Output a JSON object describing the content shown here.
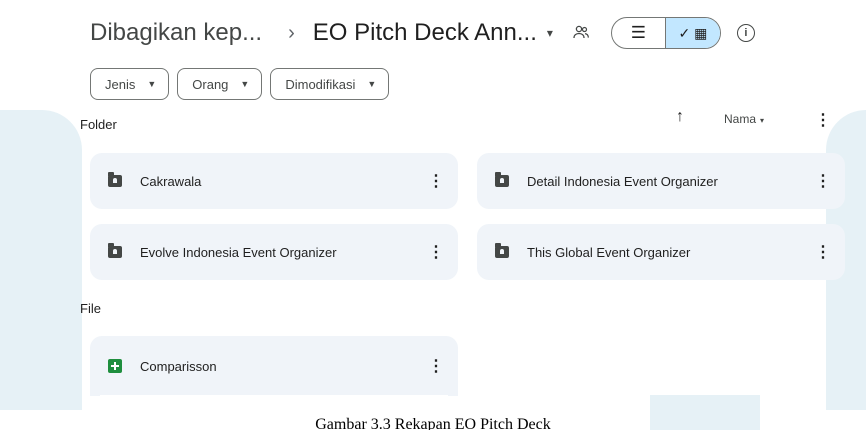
{
  "header": {
    "parent_crumb": "Dibagikan kep...",
    "separator": "›",
    "current_folder": "EO Pitch Deck Ann...",
    "dropdown_caret": "▾",
    "share_icon": "people-icon",
    "view_list_glyph": "☰",
    "view_grid_glyph": "✓ ▦",
    "info_glyph": "i"
  },
  "filters": [
    {
      "label": "Jenis"
    },
    {
      "label": "Orang"
    },
    {
      "label": "Dimodifikasi"
    }
  ],
  "sort": {
    "arrow": "↑",
    "field": "Nama",
    "caret": "▾",
    "more": "⋮"
  },
  "sections": {
    "folder_label": "Folder",
    "file_label": "File"
  },
  "folders": [
    {
      "name": "Cakrawala"
    },
    {
      "name": "Detail Indonesia Event Organizer"
    },
    {
      "name": "Evolve Indonesia Event Organizer"
    },
    {
      "name": "This Global Event Organizer"
    }
  ],
  "files": [
    {
      "name": "Comparisson",
      "type": "spreadsheet"
    }
  ],
  "more_glyph": "⋮",
  "caption": "Gambar 3.3 Rekapan EO Pitch Deck",
  "colors": {
    "grid_toggle_active": "#c2e7ff",
    "card_bg": "#f0f4f9",
    "sheets_green": "#1e8e3e",
    "watermark": "#e6f1f6"
  }
}
